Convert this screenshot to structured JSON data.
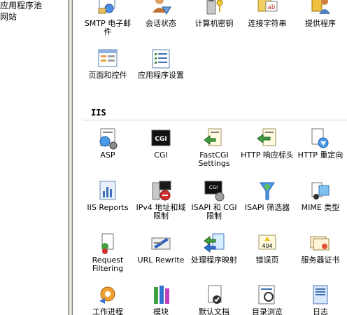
{
  "tree": {
    "items": [
      {
        "label": "应用程序池"
      },
      {
        "label": "网站"
      }
    ]
  },
  "top_row": [
    {
      "label": "SMTP 电子邮件",
      "icon": "smtp-email-icon"
    },
    {
      "label": "会话状态",
      "icon": "session-state-icon"
    },
    {
      "label": "计算机密钥",
      "icon": "machine-key-icon"
    },
    {
      "label": "连接字符串",
      "icon": "connection-strings-icon"
    },
    {
      "label": "提供程序",
      "icon": "providers-icon"
    }
  ],
  "row2": [
    {
      "label": "页面和控件",
      "icon": "pages-controls-icon"
    },
    {
      "label": "应用程序设置",
      "icon": "app-settings-icon"
    }
  ],
  "iis_section": {
    "title": "IIS"
  },
  "iis_items": [
    {
      "label": "ASP",
      "icon": "asp-icon"
    },
    {
      "label": "CGI",
      "icon": "cgi-icon"
    },
    {
      "label": "FastCGI Settings",
      "icon": "fastcgi-icon"
    },
    {
      "label": "HTTP 响应标头",
      "icon": "http-headers-icon"
    },
    {
      "label": "HTTP 重定向",
      "icon": "http-redirect-icon"
    },
    {
      "label": "IIS Reports",
      "icon": "iis-reports-icon"
    },
    {
      "label": "IPv4 地址和域限制",
      "icon": "ipv4-restrictions-icon"
    },
    {
      "label": "ISAPI 和 CGI 限制",
      "icon": "isapi-cgi-icon"
    },
    {
      "label": "ISAPI 筛选器",
      "icon": "isapi-filters-icon"
    },
    {
      "label": "MIME 类型",
      "icon": "mime-types-icon"
    },
    {
      "label": "Request Filtering",
      "icon": "request-filtering-icon"
    },
    {
      "label": "URL Rewrite",
      "icon": "url-rewrite-icon"
    },
    {
      "label": "处理程序映射",
      "icon": "handler-mappings-icon"
    },
    {
      "label": "错误页",
      "icon": "error-pages-icon"
    },
    {
      "label": "服务器证书",
      "icon": "server-certs-icon"
    },
    {
      "label": "工作进程",
      "icon": "worker-process-icon"
    },
    {
      "label": "模块",
      "icon": "modules-icon"
    },
    {
      "label": "默认文档",
      "icon": "default-doc-icon"
    },
    {
      "label": "目录浏览",
      "icon": "dir-browsing-icon"
    },
    {
      "label": "日志",
      "icon": "logging-icon"
    }
  ],
  "colors": {
    "section_line": "#c8d4e8",
    "splitter": "#d4d0c8"
  }
}
